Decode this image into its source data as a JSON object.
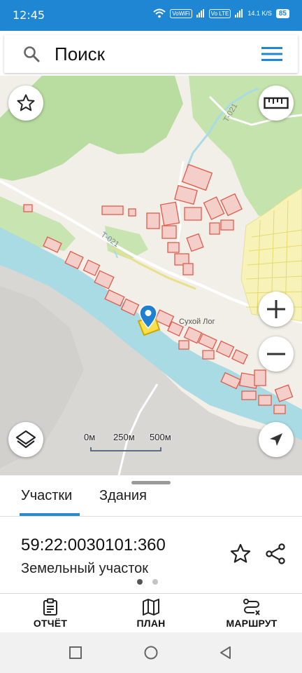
{
  "status_bar": {
    "time": "12:45",
    "vowifi": "VoWiFi",
    "volte": "Vo LTE",
    "speed": "14.1 K/S",
    "battery": "85"
  },
  "search": {
    "placeholder": "Поиск"
  },
  "map": {
    "road_label": "Т-021",
    "town_label": "Сухой Лог",
    "scale": {
      "labels": [
        "0м",
        "250м",
        "500м"
      ]
    }
  },
  "sheet": {
    "tabs": [
      {
        "label": "Участки",
        "active": true
      },
      {
        "label": "Здания",
        "active": false
      }
    ],
    "cadastral_number": "59:22:0030101:360",
    "object_type": "Земельный участок",
    "page_count": 2,
    "page_active": 1
  },
  "actions": {
    "report": "ОТЧЁТ",
    "plan": "ПЛАН",
    "route": "МАРШРУТ"
  },
  "colors": {
    "status_bar": "#1f86d3",
    "accent": "#2a8bc8",
    "water": "#a9dbe4",
    "forest": "#b9dda0",
    "land": "#f2efe9",
    "parcel_fill": "#f4cfc9",
    "parcel_stroke": "#e15b4c",
    "farmland_fill": "#f7f3b8"
  },
  "icons": {
    "search": "search-icon",
    "menu": "menu-icon",
    "favorite": "star-icon",
    "ruler": "ruler-icon",
    "zoom_in": "plus-icon",
    "zoom_out": "minus-icon",
    "layers": "layers-icon",
    "locate": "navigation-arrow-icon",
    "share": "share-icon",
    "report": "clipboard-icon",
    "plan": "map-icon",
    "route": "route-icon"
  }
}
